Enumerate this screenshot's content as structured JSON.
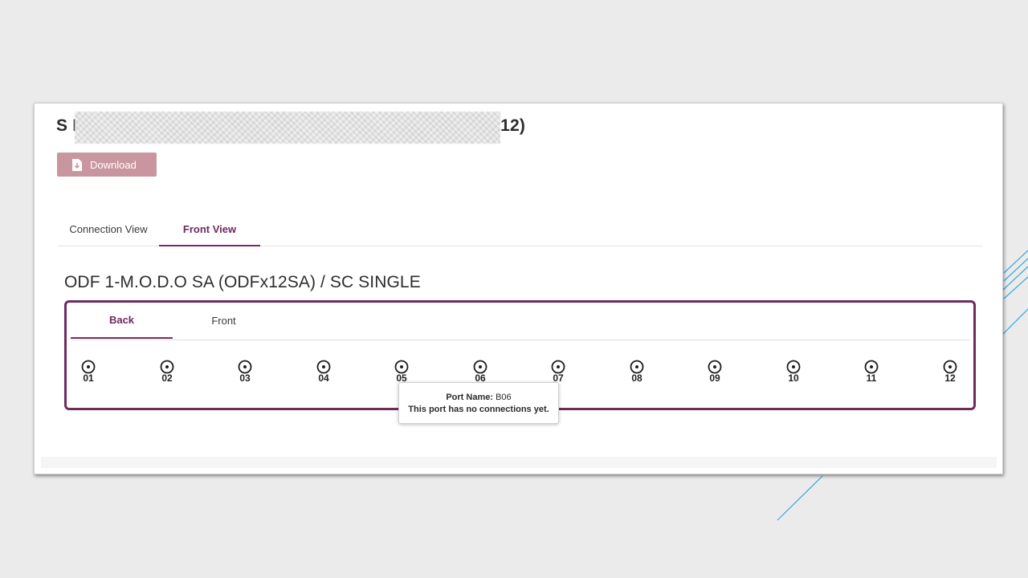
{
  "page": {
    "title_prefix": "S L",
    "title_suffix": "312)",
    "download_label": "Download"
  },
  "tabs": [
    {
      "label": "Connection View",
      "active": false
    },
    {
      "label": "Front View",
      "active": true
    }
  ],
  "odf": {
    "title": "ODF 1-M.O.D.O SA (ODFx12SA) / SC SINGLE",
    "subtabs": [
      {
        "label": "Back",
        "active": true
      },
      {
        "label": "Front",
        "active": false
      }
    ],
    "ports": [
      "01",
      "02",
      "03",
      "04",
      "05",
      "06",
      "07",
      "08",
      "09",
      "10",
      "11",
      "12"
    ]
  },
  "tooltip": {
    "port_name_label": "Port Name:",
    "port_name_value": "B06",
    "message": "This port has no connections yet."
  },
  "colors": {
    "accent": "#6e2b5f",
    "download_button": "#c9969f",
    "decor_lines": "#3aa7d9"
  }
}
